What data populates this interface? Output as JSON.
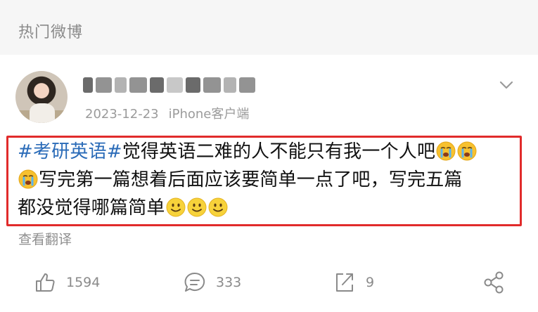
{
  "section": {
    "title": "热门微博"
  },
  "post": {
    "username": "(blurred)",
    "date": "2023-12-23",
    "source": "iPhone客户端",
    "hashtag": "#考研英语#",
    "line1_text": "觉得英语二难的人不能只有我一个人吧",
    "line2_text": "写完第一篇想着后面应该要简单一点了吧，写完五篇",
    "line3_text": "都没觉得哪篇简单",
    "emojis": [
      "crying-face-emoji",
      "crying-face-emoji",
      "crying-face-emoji",
      "smiley-emoji",
      "smiley-emoji",
      "smiley-emoji"
    ],
    "translate_label": "查看翻译",
    "highlight_color": "#e12b2b"
  },
  "actions": {
    "likes": "1594",
    "comments": "333",
    "reposts": "9"
  },
  "colors": {
    "hashtag": "#2a6bb8",
    "meta": "#9b9b9b",
    "header_bg": "#f6f6f6"
  }
}
